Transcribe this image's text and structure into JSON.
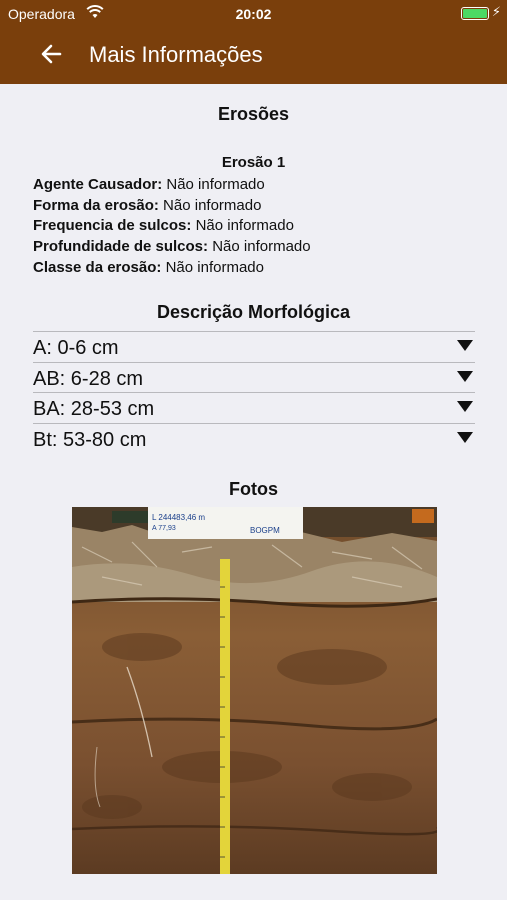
{
  "status_bar": {
    "carrier": "Operadora",
    "time": "20:02",
    "battery_level": 1.0,
    "charging": true
  },
  "app_bar": {
    "title": "Mais Informações",
    "back_icon": "arrow-left-icon"
  },
  "erosions": {
    "heading": "Erosões",
    "items": [
      {
        "title": "Erosão 1",
        "fields": [
          {
            "label": "Agente Causador:",
            "value": "Não informado"
          },
          {
            "label": "Forma da erosão:",
            "value": "Não informado"
          },
          {
            "label": "Frequencia de sulcos:",
            "value": "Não informado"
          },
          {
            "label": "Profundidade de sulcos:",
            "value": "Não informado"
          },
          {
            "label": "Classe da erosão:",
            "value": "Não informado"
          }
        ]
      }
    ]
  },
  "morphology": {
    "heading": "Descrição Morfológica",
    "horizons": [
      {
        "label": "A: 0-6 cm"
      },
      {
        "label": "AB: 6-28 cm"
      },
      {
        "label": "BA: 28-53 cm"
      },
      {
        "label": "Bt: 53-80 cm"
      }
    ]
  },
  "photos": {
    "heading": "Fotos",
    "items": [
      {
        "label_lines": [
          "L 244483,46 m",
          "A 77,93",
          "BOGPM"
        ]
      }
    ]
  },
  "colors": {
    "brand": "#7a3f0c",
    "background": "#efeff4",
    "battery": "#4cd964"
  }
}
